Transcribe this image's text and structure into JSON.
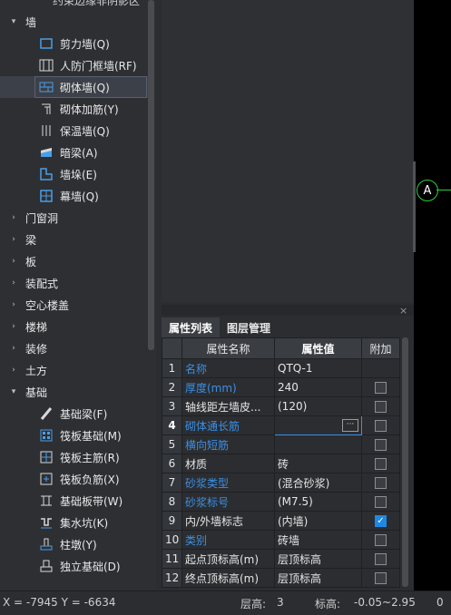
{
  "tree": {
    "top_partial": "约束边缘非阴影区",
    "items": [
      {
        "kind": "cat",
        "arrow": "▾",
        "label": "墙"
      },
      {
        "kind": "sub",
        "icon": "shear-wall-icon",
        "label": "剪力墙(Q)"
      },
      {
        "kind": "sub",
        "icon": "civil-defense-wall-icon",
        "label": "人防门框墙(RF)"
      },
      {
        "kind": "sub",
        "icon": "masonry-wall-icon",
        "label": "砌体墙(Q)",
        "selected": true
      },
      {
        "kind": "sub",
        "icon": "masonry-rebar-icon",
        "label": "砌体加筋(Y)"
      },
      {
        "kind": "sub",
        "icon": "insulation-wall-icon",
        "label": "保温墙(Q)"
      },
      {
        "kind": "sub",
        "icon": "hidden-beam-icon",
        "label": "暗梁(A)"
      },
      {
        "kind": "sub",
        "icon": "wall-pier-icon",
        "label": "墙垛(E)"
      },
      {
        "kind": "sub",
        "icon": "curtain-wall-icon",
        "label": "幕墙(Q)"
      },
      {
        "kind": "cat",
        "arrow": "›",
        "label": "门窗洞"
      },
      {
        "kind": "cat",
        "arrow": "›",
        "label": "梁"
      },
      {
        "kind": "cat",
        "arrow": "›",
        "label": "板"
      },
      {
        "kind": "cat",
        "arrow": "›",
        "label": "装配式"
      },
      {
        "kind": "cat",
        "arrow": "›",
        "label": "空心楼盖"
      },
      {
        "kind": "cat",
        "arrow": "›",
        "label": "楼梯"
      },
      {
        "kind": "cat",
        "arrow": "›",
        "label": "装修"
      },
      {
        "kind": "cat",
        "arrow": "›",
        "label": "土方"
      },
      {
        "kind": "cat",
        "arrow": "▾",
        "label": "基础"
      },
      {
        "kind": "sub",
        "icon": "foundation-beam-icon",
        "label": "基础梁(F)"
      },
      {
        "kind": "sub",
        "icon": "raft-foundation-icon",
        "label": "筏板基础(M)"
      },
      {
        "kind": "sub",
        "icon": "raft-main-rebar-icon",
        "label": "筏板主筋(R)"
      },
      {
        "kind": "sub",
        "icon": "raft-negative-rebar-icon",
        "label": "筏板负筋(X)"
      },
      {
        "kind": "sub",
        "icon": "foundation-band-icon",
        "label": "基础板带(W)"
      },
      {
        "kind": "sub",
        "icon": "sump-pit-icon",
        "label": "集水坑(K)"
      },
      {
        "kind": "sub",
        "icon": "column-pier-icon",
        "label": "柱墩(Y)"
      },
      {
        "kind": "sub",
        "icon": "isolated-footing-icon",
        "label": "独立基础(D)"
      }
    ]
  },
  "canvas": {
    "axis_label": "A"
  },
  "panel": {
    "close_label": "×",
    "tabs": [
      {
        "label": "属性列表",
        "active": true
      },
      {
        "label": "图层管理",
        "active": false
      }
    ],
    "headers": {
      "name": "属性名称",
      "value": "属性值",
      "extra": "附加"
    },
    "rows": [
      {
        "num": "1",
        "name": "名称",
        "value": "QTQ-1",
        "blue": true,
        "checkbox": false
      },
      {
        "num": "2",
        "name": "厚度(mm)",
        "value": "240",
        "blue": true,
        "checkbox": true,
        "checked": false
      },
      {
        "num": "3",
        "name": "轴线距左墙皮...",
        "value": "(120)",
        "blue": false,
        "checkbox": true,
        "checked": false
      },
      {
        "num": "4",
        "name": "砌体通长筋",
        "value": "",
        "blue": true,
        "checkbox": true,
        "checked": false,
        "editing": true
      },
      {
        "num": "5",
        "name": "横向短筋",
        "value": "",
        "blue": true,
        "checkbox": true,
        "checked": false
      },
      {
        "num": "6",
        "name": "材质",
        "value": "砖",
        "blue": false,
        "checkbox": true,
        "checked": false
      },
      {
        "num": "7",
        "name": "砂浆类型",
        "value": "(混合砂浆)",
        "blue": true,
        "checkbox": true,
        "checked": false
      },
      {
        "num": "8",
        "name": "砂浆标号",
        "value": "(M7.5)",
        "blue": true,
        "checkbox": true,
        "checked": false
      },
      {
        "num": "9",
        "name": "内/外墙标志",
        "value": "(内墙)",
        "blue": false,
        "checkbox": true,
        "checked": true
      },
      {
        "num": "10",
        "name": "类别",
        "value": "砖墙",
        "blue": true,
        "checkbox": true,
        "checked": false
      },
      {
        "num": "11",
        "name": "起点顶标高(m)",
        "value": "层顶标高",
        "blue": false,
        "checkbox": true,
        "checked": false
      },
      {
        "num": "12",
        "name": "终点顶标高(m)",
        "value": "层顶标高",
        "blue": false,
        "checkbox": true,
        "checked": false
      }
    ]
  },
  "status": {
    "coords": "X = -7945 Y = -6634",
    "floor_label": "层高:",
    "floor_value": "3",
    "elev_label": "标高:",
    "elev_value": "-0.05~2.95",
    "extra": "0"
  }
}
